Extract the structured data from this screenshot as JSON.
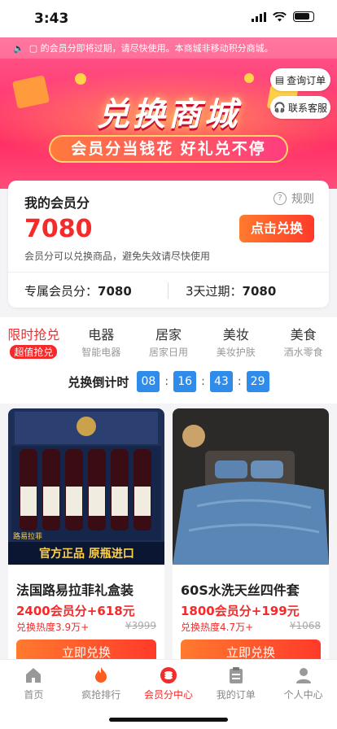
{
  "status": {
    "time": "3:43"
  },
  "banner": {
    "notice": "▢ 的会员分即将过期，请尽快使用。本商城非移动积分商城。",
    "title": "兑换商城",
    "subtitle": "会员分当钱花 好礼兑不停",
    "query_order": "查询订单",
    "contact_service": "联系客服"
  },
  "points": {
    "title": "我的会员分",
    "rules": "规则",
    "value": "7080",
    "redeem_button": "点击兑换",
    "description": "会员分可以兑换商品，避免失效请尽快使用",
    "exclusive_label": "专属会员分：",
    "exclusive_value": "7080",
    "expire_label": "3天过期：",
    "expire_value": "7080"
  },
  "categories": [
    {
      "main": "限时抢兑",
      "sub": "超值抢兑"
    },
    {
      "main": "电器",
      "sub": "智能电器"
    },
    {
      "main": "居家",
      "sub": "居家日用"
    },
    {
      "main": "美妆",
      "sub": "美妆护肤"
    },
    {
      "main": "美食",
      "sub": "酒水零食"
    }
  ],
  "countdown": {
    "label": "兑换倒计时",
    "days": "08",
    "hours": "16",
    "minutes": "43",
    "seconds": "29",
    "sep": ":"
  },
  "products": [
    {
      "name": "法国路易拉菲礼盒装",
      "price": "2400会员分+618元",
      "heat": "兑换热度3.9万+",
      "original": "¥3999",
      "button": "立即兑换",
      "img_brand": "路易拉菲",
      "img_tagline": "官方正品 原瓶进口"
    },
    {
      "name": "60S水洗天丝四件套",
      "price": "1800会员分+199元",
      "heat": "兑换热度4.7万+",
      "original": "¥1068",
      "button": "立即兑换"
    }
  ],
  "tabbar": [
    {
      "label": "首页",
      "icon": "home-icon"
    },
    {
      "label": "疯抢排行",
      "icon": "flame-icon"
    },
    {
      "label": "会员分中心",
      "icon": "coins-icon"
    },
    {
      "label": "我的订单",
      "icon": "clipboard-icon"
    },
    {
      "label": "个人中心",
      "icon": "user-icon"
    }
  ],
  "colors": {
    "accent_red": "#f52a2a",
    "banner_pink": "#ff3f77",
    "countdown_blue": "#2f8ceb",
    "button_orange": "#ff7a2e"
  }
}
